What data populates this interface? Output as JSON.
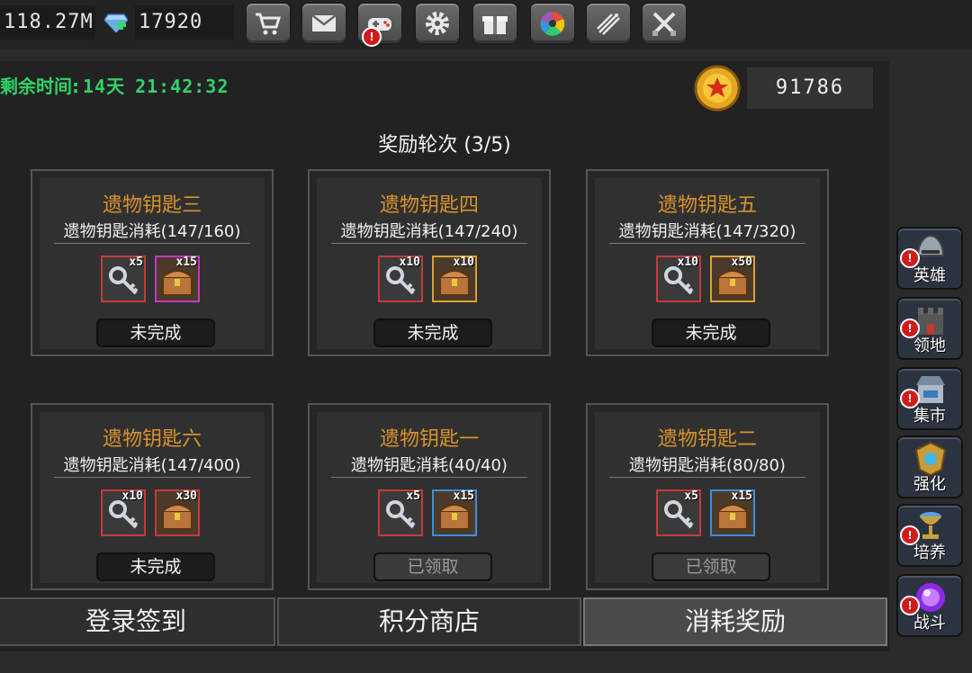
{
  "top_bar": {
    "gold_value": "118.27M",
    "gem_value": "17920",
    "buttons": [
      "shop-cart-icon",
      "mail-icon",
      "gamepad-icon",
      "settings-gear-icon",
      "gift-icon",
      "color-wheel-icon",
      "fireworks-icon",
      "crossed-swords-icon"
    ]
  },
  "event": {
    "remaining_label": "剩余时间:",
    "remaining_days": "14天",
    "remaining_time": "21:42:32",
    "points_value": "91786",
    "round_title": "奖励轮次 (3/5)"
  },
  "cards": [
    {
      "title": "遗物钥匙三",
      "req": "遗物钥匙消耗(147/160)",
      "items": [
        {
          "qty": "x5",
          "color": "#c73a3a"
        },
        {
          "qty": "x15",
          "color": "#c23ac0"
        }
      ],
      "status": "未完成",
      "done": false
    },
    {
      "title": "遗物钥匙四",
      "req": "遗物钥匙消耗(147/240)",
      "items": [
        {
          "qty": "x10",
          "color": "#c73a3a"
        },
        {
          "qty": "x10",
          "color": "#e0a030"
        }
      ],
      "status": "未完成",
      "done": false
    },
    {
      "title": "遗物钥匙五",
      "req": "遗物钥匙消耗(147/320)",
      "items": [
        {
          "qty": "x10",
          "color": "#c73a3a"
        },
        {
          "qty": "x50",
          "color": "#e0a030"
        }
      ],
      "status": "未完成",
      "done": false
    },
    {
      "title": "遗物钥匙六",
      "req": "遗物钥匙消耗(147/400)",
      "items": [
        {
          "qty": "x10",
          "color": "#c73a3a"
        },
        {
          "qty": "x30",
          "color": "#c73a3a"
        }
      ],
      "status": "未完成",
      "done": false
    },
    {
      "title": "遗物钥匙一",
      "req": "遗物钥匙消耗(40/40)",
      "items": [
        {
          "qty": "x5",
          "color": "#c73a3a"
        },
        {
          "qty": "x15",
          "color": "#3a8fe0"
        }
      ],
      "status": "已领取",
      "done": true
    },
    {
      "title": "遗物钥匙二",
      "req": "遗物钥匙消耗(80/80)",
      "items": [
        {
          "qty": "x5",
          "color": "#c73a3a"
        },
        {
          "qty": "x15",
          "color": "#3a8fe0"
        }
      ],
      "status": "已领取",
      "done": true
    }
  ],
  "tabs": [
    {
      "label": "登录签到",
      "active": false
    },
    {
      "label": "积分商店",
      "active": false
    },
    {
      "label": "消耗奖励",
      "active": true
    }
  ],
  "sidebar": [
    {
      "label": "英雄",
      "icon": "helmet-icon"
    },
    {
      "label": "领地",
      "icon": "castle-icon"
    },
    {
      "label": "集市",
      "icon": "market-icon"
    },
    {
      "label": "强化",
      "icon": "shield-emblem-icon"
    },
    {
      "label": "培养",
      "icon": "chalice-icon"
    },
    {
      "label": "战斗",
      "icon": "purple-orb-icon"
    }
  ],
  "colors": {
    "accent_green": "#2fd36a",
    "title_gold": "#d8922c",
    "alert_red": "#d21a1a"
  }
}
